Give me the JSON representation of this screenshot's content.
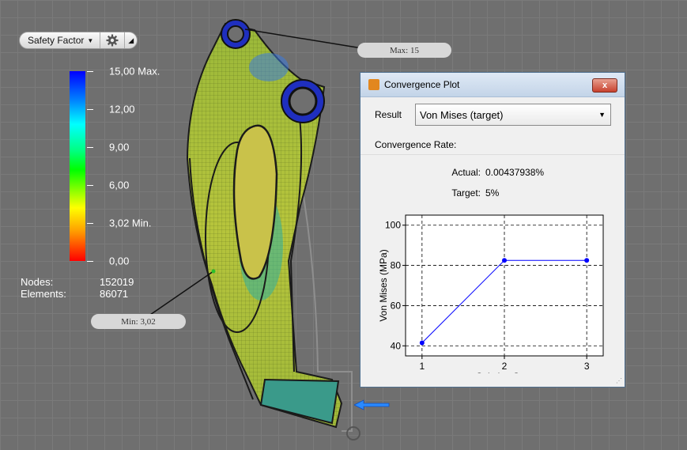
{
  "toolbar": {
    "result_label": "Safety Factor",
    "caret_icon": "caret-down-icon",
    "settings_icon": "gear-icon",
    "collapse_icon": "collapse-triangle-icon"
  },
  "legend": {
    "labels": [
      "15,00 Max.",
      "12,00",
      "9,00",
      "6,00",
      "3,02 Min.",
      "0,00"
    ],
    "colors": [
      "#0000ff",
      "#00ffff",
      "#00ff00",
      "#ffff00",
      "#ff0000"
    ]
  },
  "stats": {
    "nodes_label": "Nodes:",
    "nodes_value": "152019",
    "elements_label": "Elements:",
    "elements_value": "86071"
  },
  "probes": {
    "max_label": "Max: 15",
    "min_label": "Min: 3,02"
  },
  "dialog": {
    "title": "Convergence Plot",
    "close_label": "x",
    "result_label": "Result",
    "result_value": "Von Mises (target)",
    "convergence_rate_label": "Convergence Rate:",
    "actual_label": "Actual:",
    "actual_value": "0.00437938%",
    "target_label": "Target:",
    "target_value": "5%"
  },
  "chart_data": {
    "type": "line",
    "x": [
      1,
      2,
      3
    ],
    "series": [
      {
        "values": [
          41.5,
          82.5,
          82.5
        ],
        "color": "#0000ff"
      }
    ],
    "xlabel": "Solution Step",
    "ylabel": "Von Mises (MPa)",
    "xticks": [
      "1",
      "2",
      "3"
    ],
    "yticks": [
      "40",
      "60",
      "80",
      "100"
    ],
    "xlim": [
      0.8,
      3.2
    ],
    "ylim": [
      35,
      105
    ],
    "grid": true
  }
}
